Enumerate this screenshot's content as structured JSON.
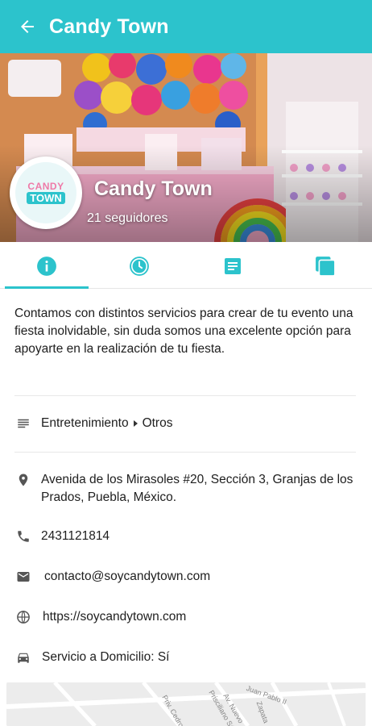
{
  "appbar": {
    "title": "Candy Town",
    "back_icon": "arrow-back-icon"
  },
  "profile": {
    "name": "Candy Town",
    "followers": "21 seguidores",
    "logo_top": "CANDY",
    "logo_bottom": "TOWN"
  },
  "tabs": [
    {
      "icon": "info-icon",
      "active": true
    },
    {
      "icon": "clock-icon",
      "active": false
    },
    {
      "icon": "article-icon",
      "active": false
    },
    {
      "icon": "gallery-icon",
      "active": false
    }
  ],
  "description": "Contamos con distintos servicios para crear de tu evento una fiesta inolvidable, sin duda somos una excelente opción para apoyarte en la realización de tu fiesta.",
  "category": {
    "main": "Entretenimiento",
    "sub": "Otros",
    "icon": "list-icon"
  },
  "contact": {
    "address": "Avenida de los Mirasoles #20, Sección 3, Granjas de los Prados, Puebla, México.",
    "phone": "2431121814",
    "email": "contacto@soycandytown.com",
    "website": "https://soycandytown.com",
    "delivery": "Servicio a Domicilio: Sí"
  },
  "map": {
    "streets": [
      "Priv. Cedros",
      "Prisciliano Sánchez",
      "Av. Nuevo",
      "Juan Pablo II",
      "Zapata"
    ]
  },
  "colors": {
    "accent": "#2cc3cc",
    "text": "#202020",
    "icon": "#555555"
  }
}
